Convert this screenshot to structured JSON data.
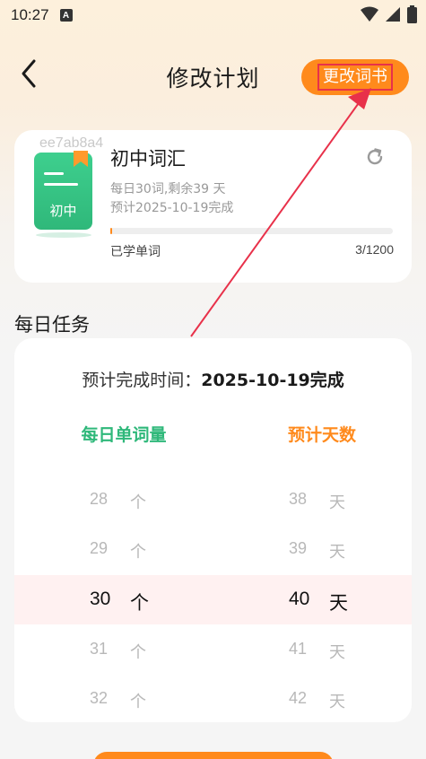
{
  "status_bar": {
    "time": "10:27",
    "notice_icon": "A"
  },
  "nav": {
    "title": "修改计划",
    "change_book_label": "更改词书"
  },
  "book": {
    "watermark": "ee7ab8a4",
    "cover_text": "初中",
    "title": "初中词汇",
    "daily_info": "每日30词,剩余39 天",
    "finish_info": "预计2025-10-19完成",
    "learned_label": "已学单词",
    "learned_count": "3/1200",
    "progress": 0.0025
  },
  "daily_task": {
    "section_title": "每日任务",
    "finish_prefix": "预计完成时间：",
    "finish_date": "2025-10-19完成",
    "col_words": "每日单词量",
    "col_days": "预计天数",
    "word_unit": "个",
    "day_unit": "天",
    "rows": [
      {
        "words": "28",
        "days": "38",
        "selected": false
      },
      {
        "words": "29",
        "days": "39",
        "selected": false
      },
      {
        "words": "30",
        "days": "40",
        "selected": true
      },
      {
        "words": "31",
        "days": "41",
        "selected": false
      },
      {
        "words": "32",
        "days": "42",
        "selected": false
      }
    ]
  },
  "colors": {
    "accent": "#ff8a1c",
    "green": "#2fb87a",
    "annotation": "#e8314a"
  },
  "icons": [
    "back-arrow-icon",
    "refresh-icon",
    "bookmark-icon",
    "wifi-icon",
    "signal-icon",
    "battery-icon"
  ]
}
